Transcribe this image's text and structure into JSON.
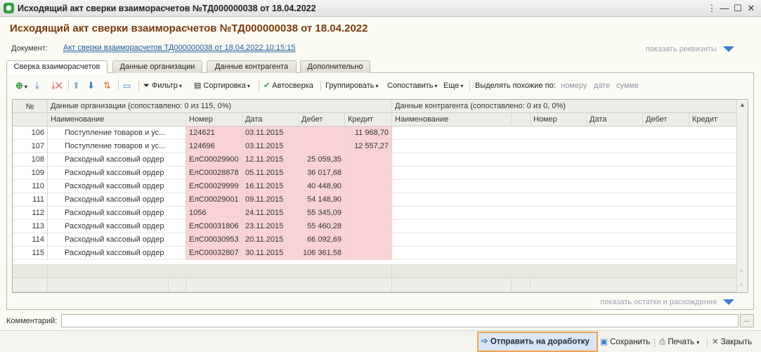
{
  "window": {
    "title": "Исходящий акт сверки взаиморасчетов №ТД000000038 от 18.04.2022",
    "controls": [
      "⋮",
      "—",
      "☐",
      "✕"
    ]
  },
  "header": {
    "title": "Исходящий акт сверки взаиморасчетов №ТД000000038 от 18.04.2022",
    "document_label": "Документ:",
    "document_link": "Акт сверки взаиморасчетов ТД000000038 от 18.04.2022 10:15:15",
    "show_details": "показать реквизиты"
  },
  "tabs": [
    "Сверка взаиморасчетов",
    "Данные организации",
    "Данные контрагента",
    "Дополнительно"
  ],
  "toolbar": {
    "filter": "Фильтр",
    "sort": "Сортировка",
    "autocheck": "Автосверка",
    "group": "Группировать",
    "match": "Сопоставить",
    "more": "Еще",
    "highlight_label": "Выделять похожие по:",
    "highlight_number": "номеру",
    "highlight_date": "дате",
    "highlight_sum": "сумме"
  },
  "grid": {
    "col_no": "№",
    "org_group": "Данные организации (сопоставлено: 0 из 115, 0%)",
    "cp_group": "Данные контрагента (сопоставлено: 0 из 0, 0%)",
    "columns": [
      "Наименование",
      "Номер",
      "Дата",
      "Дебет",
      "Кредит"
    ],
    "rows": [
      {
        "n": "106",
        "name": "Поступление товаров и ус...",
        "number": "124621",
        "date": "03.11.2015",
        "debit": "",
        "credit": "11 968,70"
      },
      {
        "n": "107",
        "name": "Поступление товаров и ус...",
        "number": "124696",
        "date": "03.11.2015",
        "debit": "",
        "credit": "12 557,27"
      },
      {
        "n": "108",
        "name": "Расходный кассовый ордер",
        "number": "ЕлС00029900",
        "date": "12.11.2015",
        "debit": "25 059,35",
        "credit": ""
      },
      {
        "n": "109",
        "name": "Расходный кассовый ордер",
        "number": "ЕлС00028878",
        "date": "05.11.2015",
        "debit": "36 017,68",
        "credit": ""
      },
      {
        "n": "110",
        "name": "Расходный кассовый ордер",
        "number": "ЕлС00029999",
        "date": "16.11.2015",
        "debit": "40 448,90",
        "credit": ""
      },
      {
        "n": "111",
        "name": "Расходный кассовый ордер",
        "number": "ЕлС00029001",
        "date": "09.11.2015",
        "debit": "54 148,90",
        "credit": ""
      },
      {
        "n": "112",
        "name": "Расходный кассовый ордер",
        "number": "1056",
        "date": "24.11.2015",
        "debit": "55 345,09",
        "credit": ""
      },
      {
        "n": "113",
        "name": "Расходный кассовый ордер",
        "number": "ЕлС00031806",
        "date": "23.11.2015",
        "debit": "55 460,28",
        "credit": ""
      },
      {
        "n": "114",
        "name": "Расходный кассовый ордер",
        "number": "ЕлС00030953",
        "date": "20.11.2015",
        "debit": "66 092,69",
        "credit": ""
      },
      {
        "n": "115",
        "name": "Расходный кассовый ордер",
        "number": "ЕлС00032807",
        "date": "30.11.2015",
        "debit": "106 361,58",
        "credit": ""
      }
    ]
  },
  "show_remainders": "показать остатки и расхождения",
  "comment": {
    "label": "Комментарий:",
    "value": "",
    "button": "..."
  },
  "bottom": {
    "send": "Отправить на доработку",
    "save": "Сохранить",
    "print": "Печать",
    "close": "Закрыть"
  },
  "colors": {
    "highlight": "#f9d3d3",
    "accent_border": "#f3a250",
    "title": "#7a3a0c",
    "link": "#1a5a9c"
  }
}
